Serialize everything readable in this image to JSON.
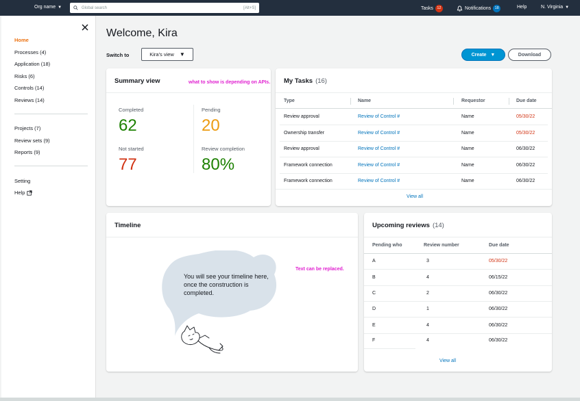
{
  "topnav": {
    "org": "Org name",
    "search_placeholder": "Global search",
    "search_shortcut": "[Alt+S]",
    "tasks_label": "Tasks",
    "tasks_count": "12",
    "notifications_label": "Notifications",
    "notifications_count": "18",
    "help": "Help",
    "region": "N. Virginia"
  },
  "sidebar": {
    "items": [
      {
        "label": "Home"
      },
      {
        "label": "Processes (4)"
      },
      {
        "label": "Application (18)"
      },
      {
        "label": "Risks (6)"
      },
      {
        "label": "Controls (14)"
      },
      {
        "label": "Reviews (14)"
      },
      {
        "label": "Projects (7)"
      },
      {
        "label": "Review sets (9)"
      },
      {
        "label": "Reports (9)"
      },
      {
        "label": "Setting"
      },
      {
        "label": "Help"
      }
    ]
  },
  "header": {
    "welcome": "Welcome, Kira",
    "switch_label": "Switch to",
    "switch_value": "Kira's view",
    "create": "Create",
    "download": "Download"
  },
  "summary": {
    "title": "Summary view",
    "annotation": "what to show is depending on APIs.",
    "stats": [
      {
        "label": "Completed",
        "value": "62",
        "color": "#1d8102"
      },
      {
        "label": "Pending",
        "value": "20",
        "color": "#ec9b11"
      },
      {
        "label": "Not started",
        "value": "77",
        "color": "#d13212"
      },
      {
        "label": "Review completion",
        "value": "80%",
        "color": "#1d8102"
      }
    ]
  },
  "tasks": {
    "title": "My Tasks",
    "count": "(16)",
    "columns": [
      "Type",
      "Name",
      "Requestor",
      "Due date"
    ],
    "rows": [
      {
        "type": "Review approval",
        "name": "Review of Control #",
        "requestor": "Name",
        "due": "05/30/22",
        "overdue": true
      },
      {
        "type": "Ownership transfer",
        "name": "Review of Control #",
        "requestor": "Name",
        "due": "05/30/22",
        "overdue": true
      },
      {
        "type": "Review approval",
        "name": "Review of Control #",
        "requestor": "Name",
        "due": "06/30/22",
        "overdue": false
      },
      {
        "type": "Framework connection",
        "name": "Review of Control #",
        "requestor": "Name",
        "due": "06/30/22",
        "overdue": false
      },
      {
        "type": "Framework connection",
        "name": "Review of Control #",
        "requestor": "Name",
        "due": "06/30/22",
        "overdue": false
      }
    ],
    "view_all": "View all"
  },
  "timeline": {
    "title": "Timeline",
    "message": "You will see your timeline here, once the construction is completed.",
    "annotation": "Text can be replaced."
  },
  "reviews": {
    "title": "Upcoming reviews",
    "count": "(14)",
    "columns": [
      "Pending who",
      "Review number",
      "Due date"
    ],
    "rows": [
      {
        "who": "A",
        "number": "3",
        "due": "05/30/22",
        "overdue": true
      },
      {
        "who": "B",
        "number": "4",
        "due": "06/15/22",
        "overdue": false
      },
      {
        "who": "C",
        "number": "2",
        "due": "06/30/22",
        "overdue": false
      },
      {
        "who": "D",
        "number": "1",
        "due": "06/30/22",
        "overdue": false
      },
      {
        "who": "E",
        "number": "4",
        "due": "06/30/22",
        "overdue": false
      },
      {
        "who": "F",
        "number": "4",
        "due": "06/30/22",
        "overdue": false
      }
    ],
    "view_all": "View all"
  },
  "colors": {
    "nav_bg": "#232f3e",
    "accent_orange": "#ec7211",
    "link_blue": "#0073bb",
    "primary_button": "#0095d3",
    "overdue_red": "#d13212",
    "annotation_magenta": "#e020d0"
  }
}
